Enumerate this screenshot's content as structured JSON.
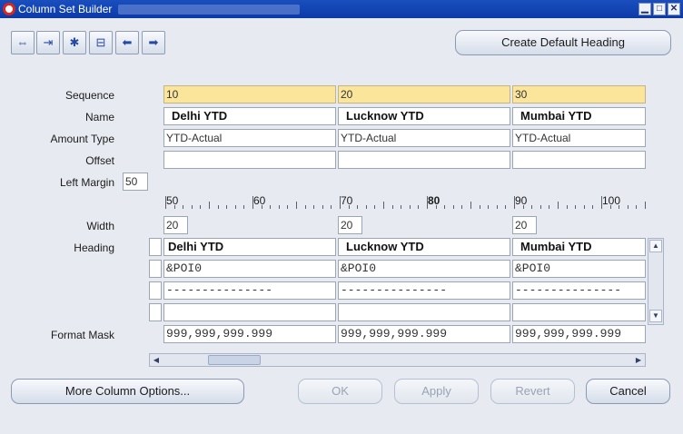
{
  "window": {
    "title": "Column Set Builder",
    "controls": [
      "▁",
      "□",
      "✕"
    ]
  },
  "toolbar": {
    "icons": [
      "add-column-icon",
      "insert-column-icon",
      "new-row-icon",
      "delete-icon",
      "move-left-icon",
      "move-right-icon"
    ],
    "glyphs": [
      "⇔",
      "⇥",
      "✱",
      "⊟",
      "⬅",
      "➡"
    ],
    "create_default_heading": "Create Default Heading"
  },
  "labels": {
    "sequence": "Sequence",
    "name": "Name",
    "amount_type": "Amount Type",
    "offset": "Offset",
    "left_margin": "Left Margin",
    "width": "Width",
    "heading": "Heading",
    "format_mask": "Format Mask"
  },
  "left_margin_value": "50",
  "ruler": [
    "50",
    "60",
    "70",
    "80",
    "90",
    "100"
  ],
  "columns": [
    {
      "sequence": "10",
      "name": "Delhi YTD",
      "amount_type": "YTD-Actual",
      "offset": "",
      "width": "20",
      "heading": [
        "Delhi YTD",
        "&POI0",
        "---------------",
        ""
      ],
      "format_mask": "999,999,999.999"
    },
    {
      "sequence": "20",
      "name": "Lucknow YTD",
      "amount_type": "YTD-Actual",
      "offset": "",
      "width": "20",
      "heading": [
        "Lucknow YTD",
        "&POI0",
        "---------------",
        ""
      ],
      "format_mask": "999,999,999.999"
    },
    {
      "sequence": "30",
      "name": "Mumbai YTD",
      "amount_type": "YTD-Actual",
      "offset": "",
      "width": "20",
      "heading": [
        "Mumbai YTD",
        "&POI0",
        "---------------",
        ""
      ],
      "format_mask": "999,999,999.999"
    }
  ],
  "buttons": {
    "more_options": "More Column Options...",
    "ok": "OK",
    "apply": "Apply",
    "revert": "Revert",
    "cancel": "Cancel"
  }
}
